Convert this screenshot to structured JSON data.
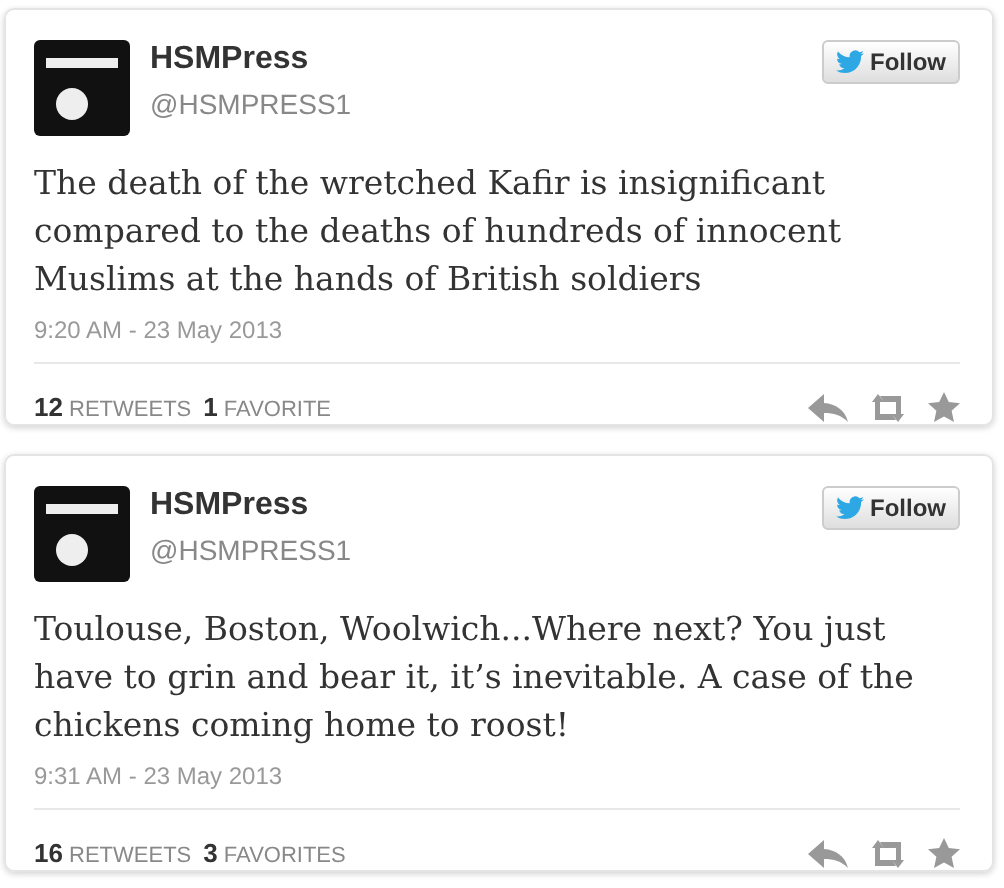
{
  "tweets": [
    {
      "name": "HSMPress",
      "handle": "@HSMPRESS1",
      "follow_label": "Follow",
      "text": "The death of the wretched Kafir is insignificant compared to the deaths of hundreds of innocent Muslims at the hands of British soldiers",
      "timestamp": "9:20 AM - 23 May 2013",
      "retweets_count": "12",
      "retweets_label": "RETWEETS",
      "favorites_count": "1",
      "favorites_label": "FAVORITE"
    },
    {
      "name": "HSMPress",
      "handle": "@HSMPRESS1",
      "follow_label": "Follow",
      "text": "Toulouse, Boston, Woolwich...Where next?  You just have to grin and bear it, it’s inevitable. A case of the chickens coming home to roost!",
      "timestamp": "9:31 AM - 23 May 2013",
      "retweets_count": "16",
      "retweets_label": "RETWEETS",
      "favorites_count": "3",
      "favorites_label": "FAVORITES"
    }
  ]
}
